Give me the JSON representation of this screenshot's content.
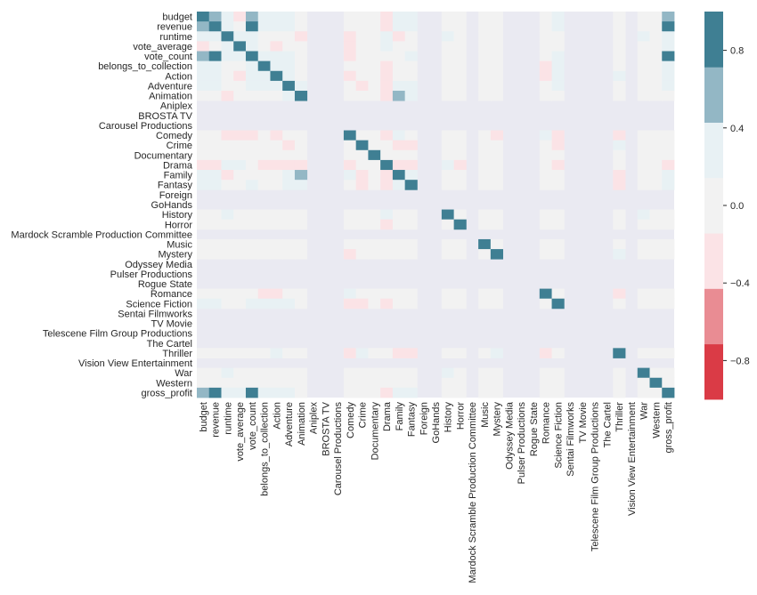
{
  "chart_data": {
    "type": "heatmap",
    "title": "",
    "xlabel": "",
    "ylabel": "",
    "variables": [
      "budget",
      "revenue",
      "runtime",
      "vote_average",
      "vote_count",
      "belongs_to_collection",
      "Action",
      "Adventure",
      "Animation",
      "Aniplex",
      "BROSTA TV",
      "Carousel Productions",
      "Comedy",
      "Crime",
      "Documentary",
      "Drama",
      "Family",
      "Fantasy",
      "Foreign",
      "GoHands",
      "History",
      "Horror",
      "Mardock Scramble Production Committee",
      "Music",
      "Mystery",
      "Odyssey Media",
      "Pulser Productions",
      "Rogue State",
      "Romance",
      "Science Fiction",
      "Sentai Filmworks",
      "TV Movie",
      "Telescene Film Group Productions",
      "The Cartel",
      "Thriller",
      "Vision View Entertainment",
      "War",
      "Western",
      "gross_profit"
    ],
    "empty_variables": [
      "Aniplex",
      "BROSTA TV",
      "Carousel Productions",
      "Foreign",
      "GoHands",
      "Mardock Scramble Production Committee",
      "Odyssey Media",
      "Pulser Productions",
      "Rogue State",
      "Sentai Filmworks",
      "TV Movie",
      "Telescene Film Group Productions",
      "The Cartel",
      "Vision View Entertainment"
    ],
    "default_value": 0.0,
    "nonzero_cells": [
      [
        "budget",
        "budget",
        1.0
      ],
      [
        "budget",
        "revenue",
        0.6
      ],
      [
        "budget",
        "runtime",
        0.25
      ],
      [
        "budget",
        "vote_average",
        -0.2
      ],
      [
        "budget",
        "vote_count",
        0.6
      ],
      [
        "budget",
        "belongs_to_collection",
        0.25
      ],
      [
        "budget",
        "Action",
        0.25
      ],
      [
        "budget",
        "Adventure",
        0.25
      ],
      [
        "budget",
        "Drama",
        -0.2
      ],
      [
        "budget",
        "Family",
        0.25
      ],
      [
        "budget",
        "Fantasy",
        0.25
      ],
      [
        "budget",
        "Science Fiction",
        0.25
      ],
      [
        "budget",
        "gross_profit",
        0.6
      ],
      [
        "revenue",
        "revenue",
        1.0
      ],
      [
        "revenue",
        "runtime",
        0.25
      ],
      [
        "revenue",
        "vote_count",
        0.8
      ],
      [
        "revenue",
        "belongs_to_collection",
        0.25
      ],
      [
        "revenue",
        "Action",
        0.25
      ],
      [
        "revenue",
        "Adventure",
        0.25
      ],
      [
        "revenue",
        "Drama",
        -0.2
      ],
      [
        "revenue",
        "Family",
        0.25
      ],
      [
        "revenue",
        "Fantasy",
        0.25
      ],
      [
        "revenue",
        "Science Fiction",
        0.25
      ],
      [
        "revenue",
        "gross_profit",
        0.8
      ],
      [
        "runtime",
        "runtime",
        1.0
      ],
      [
        "runtime",
        "vote_average",
        0.25
      ],
      [
        "runtime",
        "vote_count",
        0.25
      ],
      [
        "runtime",
        "Animation",
        -0.2
      ],
      [
        "runtime",
        "Comedy",
        -0.2
      ],
      [
        "runtime",
        "Drama",
        0.25
      ],
      [
        "runtime",
        "Family",
        -0.2
      ],
      [
        "runtime",
        "History",
        0.25
      ],
      [
        "runtime",
        "War",
        0.25
      ],
      [
        "runtime",
        "gross_profit",
        0.25
      ],
      [
        "vote_average",
        "vote_average",
        1.0
      ],
      [
        "vote_average",
        "vote_count",
        0.25
      ],
      [
        "vote_average",
        "Action",
        -0.2
      ],
      [
        "vote_average",
        "Comedy",
        -0.2
      ],
      [
        "vote_average",
        "Drama",
        0.25
      ],
      [
        "vote_average",
        "gross_profit",
        0.25
      ],
      [
        "vote_count",
        "vote_count",
        1.0
      ],
      [
        "vote_count",
        "belongs_to_collection",
        0.25
      ],
      [
        "vote_count",
        "Action",
        0.25
      ],
      [
        "vote_count",
        "Adventure",
        0.25
      ],
      [
        "vote_count",
        "Comedy",
        -0.2
      ],
      [
        "vote_count",
        "Fantasy",
        0.25
      ],
      [
        "vote_count",
        "Science Fiction",
        0.25
      ],
      [
        "vote_count",
        "gross_profit",
        0.8
      ],
      [
        "belongs_to_collection",
        "belongs_to_collection",
        1.0
      ],
      [
        "belongs_to_collection",
        "Action",
        0.25
      ],
      [
        "belongs_to_collection",
        "Adventure",
        0.25
      ],
      [
        "belongs_to_collection",
        "Drama",
        -0.2
      ],
      [
        "belongs_to_collection",
        "Romance",
        -0.2
      ],
      [
        "belongs_to_collection",
        "Science Fiction",
        0.25
      ],
      [
        "belongs_to_collection",
        "gross_profit",
        0.25
      ],
      [
        "Action",
        "Action",
        1.0
      ],
      [
        "Action",
        "Adventure",
        0.25
      ],
      [
        "Action",
        "Comedy",
        -0.2
      ],
      [
        "Action",
        "Drama",
        -0.2
      ],
      [
        "Action",
        "Romance",
        -0.2
      ],
      [
        "Action",
        "Science Fiction",
        0.25
      ],
      [
        "Action",
        "Thriller",
        0.25
      ],
      [
        "Action",
        "gross_profit",
        0.25
      ],
      [
        "Adventure",
        "Adventure",
        1.0
      ],
      [
        "Adventure",
        "Animation",
        0.25
      ],
      [
        "Adventure",
        "Crime",
        -0.2
      ],
      [
        "Adventure",
        "Drama",
        -0.2
      ],
      [
        "Adventure",
        "Family",
        0.25
      ],
      [
        "Adventure",
        "Fantasy",
        0.25
      ],
      [
        "Adventure",
        "Science Fiction",
        0.25
      ],
      [
        "Adventure",
        "gross_profit",
        0.25
      ],
      [
        "Animation",
        "Animation",
        1.0
      ],
      [
        "Animation",
        "Drama",
        -0.2
      ],
      [
        "Animation",
        "Family",
        0.6
      ],
      [
        "Animation",
        "Fantasy",
        0.25
      ],
      [
        "Comedy",
        "Comedy",
        1.0
      ],
      [
        "Comedy",
        "Drama",
        -0.2
      ],
      [
        "Comedy",
        "Family",
        0.25
      ],
      [
        "Comedy",
        "Mystery",
        -0.2
      ],
      [
        "Comedy",
        "Romance",
        0.25
      ],
      [
        "Comedy",
        "Science Fiction",
        -0.2
      ],
      [
        "Comedy",
        "Thriller",
        -0.2
      ],
      [
        "Crime",
        "Crime",
        1.0
      ],
      [
        "Crime",
        "Family",
        -0.2
      ],
      [
        "Crime",
        "Fantasy",
        -0.2
      ],
      [
        "Crime",
        "Science Fiction",
        -0.2
      ],
      [
        "Crime",
        "Thriller",
        0.25
      ],
      [
        "Documentary",
        "Documentary",
        1.0
      ],
      [
        "Drama",
        "Drama",
        1.0
      ],
      [
        "Drama",
        "Family",
        -0.2
      ],
      [
        "Drama",
        "Fantasy",
        -0.2
      ],
      [
        "Drama",
        "History",
        0.25
      ],
      [
        "Drama",
        "Horror",
        -0.2
      ],
      [
        "Drama",
        "Science Fiction",
        -0.2
      ],
      [
        "Drama",
        "gross_profit",
        -0.2
      ],
      [
        "Family",
        "Family",
        1.0
      ],
      [
        "Family",
        "Fantasy",
        0.25
      ],
      [
        "Family",
        "Thriller",
        -0.2
      ],
      [
        "Family",
        "gross_profit",
        0.25
      ],
      [
        "Fantasy",
        "Fantasy",
        1.0
      ],
      [
        "Fantasy",
        "Thriller",
        -0.2
      ],
      [
        "Fantasy",
        "gross_profit",
        0.25
      ],
      [
        "History",
        "History",
        1.0
      ],
      [
        "History",
        "War",
        0.25
      ],
      [
        "Horror",
        "Horror",
        1.0
      ],
      [
        "Music",
        "Music",
        1.0
      ],
      [
        "Mystery",
        "Mystery",
        1.0
      ],
      [
        "Mystery",
        "Thriller",
        0.25
      ],
      [
        "Romance",
        "Romance",
        1.0
      ],
      [
        "Romance",
        "Thriller",
        -0.2
      ],
      [
        "Science Fiction",
        "Science Fiction",
        1.0
      ],
      [
        "Thriller",
        "Thriller",
        1.0
      ],
      [
        "War",
        "War",
        1.0
      ],
      [
        "Western",
        "Western",
        1.0
      ],
      [
        "gross_profit",
        "gross_profit",
        1.0
      ]
    ],
    "value_range": [
      -1.0,
      1.0
    ],
    "colorbar": {
      "ticks": [
        0.8,
        0.4,
        0.0,
        -0.4,
        -0.8
      ],
      "tick_labels": [
        "0.8",
        "0.4",
        "0.0",
        "−0.4",
        "−0.8"
      ],
      "bins": 7,
      "colors_low_to_high": [
        "#da3b46",
        "#e98c93",
        "#fbe3e6",
        "#f2f2f2",
        "#e8f1f4",
        "#93b7c5",
        "#3f7f93"
      ],
      "placement": "right"
    },
    "missing_color": "#eaeaf2",
    "grid": false
  }
}
